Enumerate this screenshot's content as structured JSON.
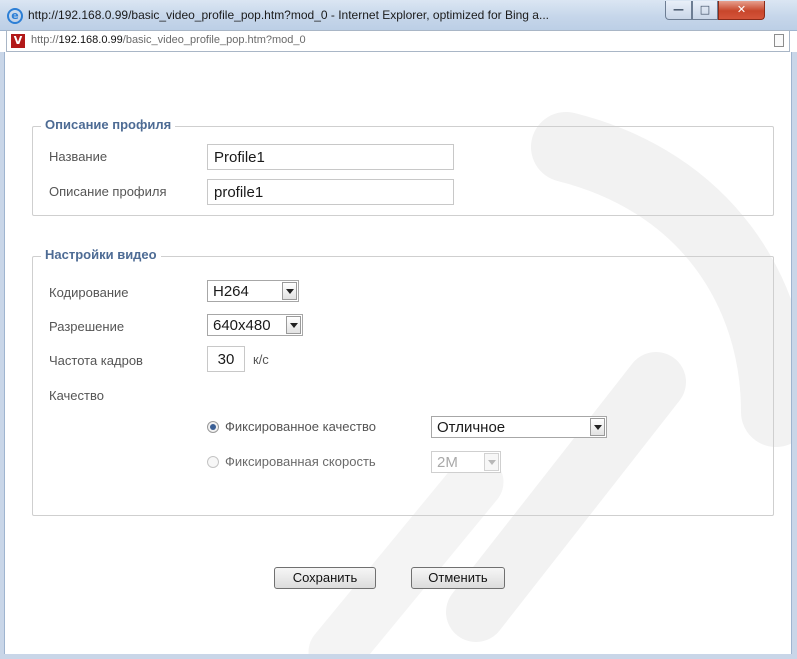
{
  "window": {
    "title": "http://192.168.0.99/basic_video_profile_pop.htm?mod_0 - Internet Explorer, optimized for Bing a...",
    "buttons": {
      "minimize_icon": "minimize-icon",
      "maximize_icon": "maximize-icon",
      "close_icon": "close-icon"
    }
  },
  "address_bar": {
    "url_prefix": "http://",
    "url_host": "192.168.0.99",
    "url_path": "/basic_video_profile_pop.htm?mod_0"
  },
  "profile_section": {
    "legend": "Описание профиля",
    "name_label": "Название",
    "name_value": "Profile1",
    "description_label": "Описание профиля",
    "description_value": "profile1"
  },
  "video_section": {
    "legend": "Настройки видео",
    "encoding_label": "Кодирование",
    "encoding_value": "H264",
    "resolution_label": "Разрешение",
    "resolution_value": "640x480",
    "framerate_label": "Частота кадров",
    "framerate_value": "30",
    "framerate_unit": "к/с",
    "quality_label": "Качество",
    "fixed_quality_label": "Фиксированное качество",
    "fixed_quality_value": "Отличное",
    "fixed_quality_selected": true,
    "fixed_bitrate_label": "Фиксированная скорость",
    "fixed_bitrate_value": "2M",
    "fixed_bitrate_selected": false
  },
  "actions": {
    "save_label": "Сохранить",
    "cancel_label": "Отменить"
  },
  "colors": {
    "legend": "#4d6b94",
    "watermark": "#f1f1f1"
  }
}
